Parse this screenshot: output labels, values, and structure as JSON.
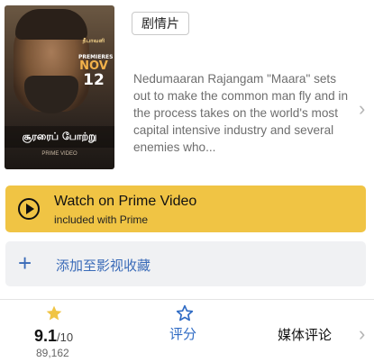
{
  "poster": {
    "brand": "தீபாவளி",
    "release_on": "PREMIERES",
    "release_month": "NOV",
    "release_day": "12",
    "title": "சூரரைப் போற்று",
    "bottom_text": "PRIME VIDEO"
  },
  "tag": {
    "label": "剧情片"
  },
  "synopsis": "Nedumaaran Rajangam \"Maara\" sets out to make the common man fly and in the process takes on the world's most capital intensive industry and several enemies who...",
  "prime_button": {
    "title": "Watch on Prime Video",
    "subtitle": "included with Prime",
    "color": "#f0c444"
  },
  "collection_button": {
    "label": "添加至影视收藏",
    "color": "#3a6bb8"
  },
  "rating": {
    "score": "9.1",
    "max": "/10",
    "votes": "89,162",
    "star_color": "#f0c444"
  },
  "rate_action": {
    "label": "评分",
    "color": "#2f6bc4"
  },
  "critics": {
    "label": "媒体评论"
  },
  "icons": {
    "play": "play-icon",
    "plus": "plus-icon",
    "star_filled": "star-filled-icon",
    "star_outline": "star-outline-icon",
    "chevron": "chevron-right-icon"
  }
}
